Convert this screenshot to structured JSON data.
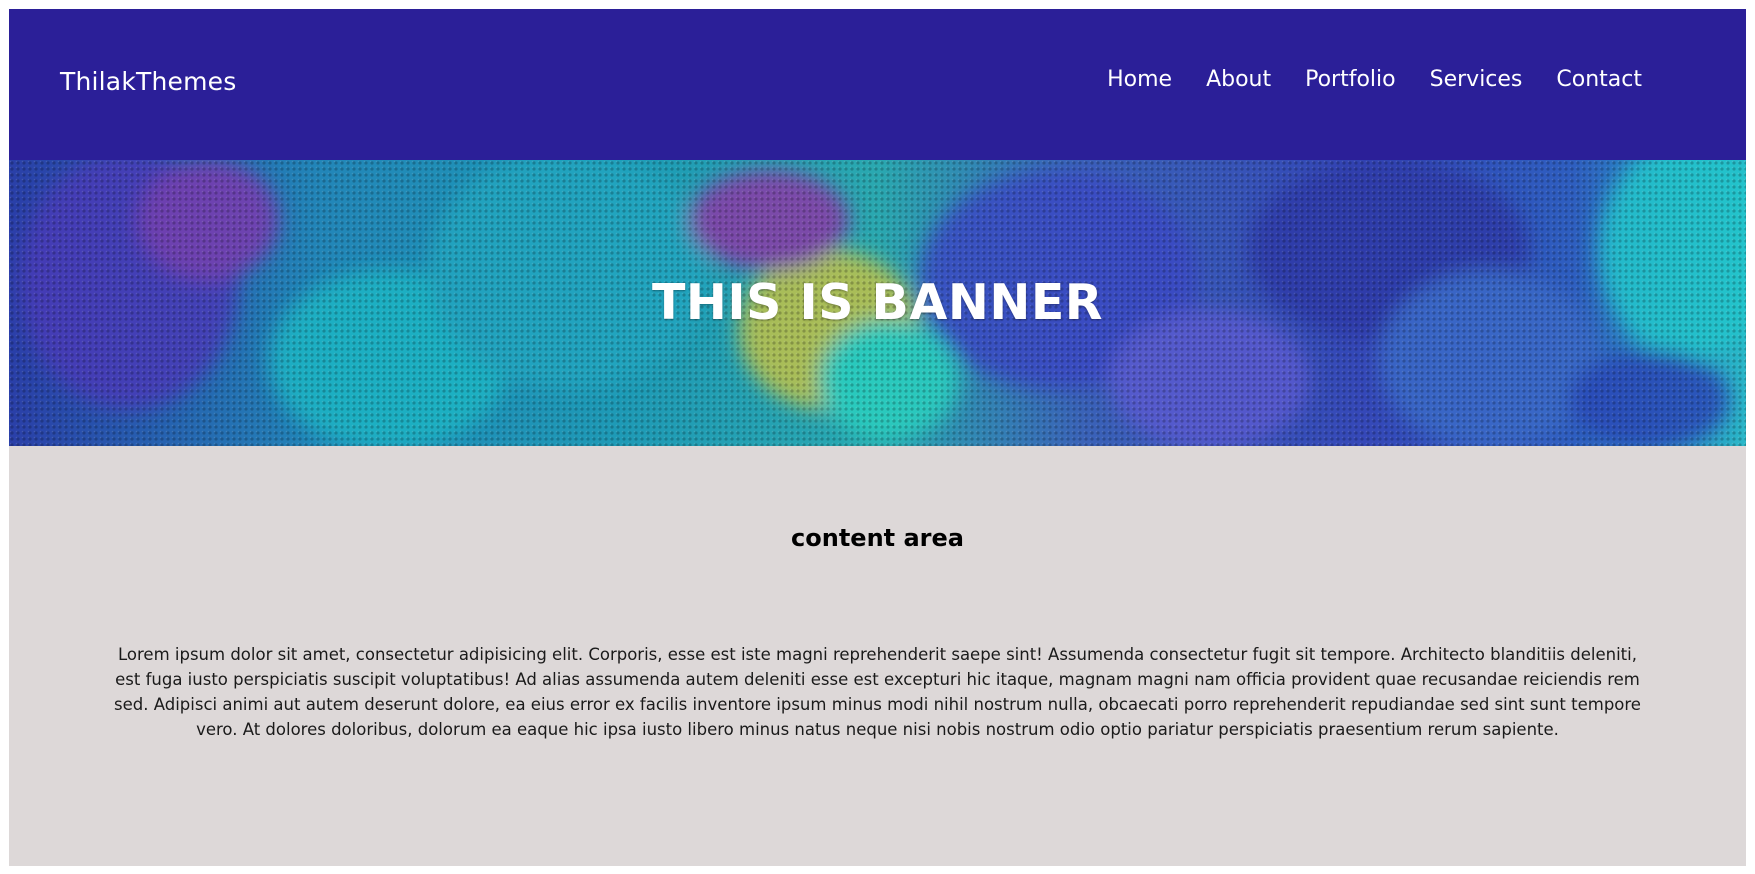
{
  "header": {
    "logo": "ThilakThemes",
    "nav": [
      "Home",
      "About",
      "Portfolio",
      "Services",
      "Contact"
    ],
    "background_color": "#2b1f98"
  },
  "banner": {
    "title": "THIS IS BANNER",
    "palette": [
      "#1a4fa0",
      "#1f9bb8",
      "#3a3fc0",
      "#6a3bb0",
      "#2cc4c8",
      "#b8c040"
    ]
  },
  "content": {
    "title": "content area",
    "body": "Lorem ipsum dolor sit amet, consectetur adipisicing elit. Corporis, esse est iste magni reprehenderit saepe sint! Assumenda consectetur fugit sit tempore. Architecto blanditiis deleniti, est fuga iusto perspiciatis suscipit voluptatibus! Ad alias assumenda autem deleniti esse est excepturi hic itaque, magnam magni nam officia provident quae recusandae reiciendis rem sed. Adipisci animi aut autem deserunt dolore, ea eius error ex facilis inventore ipsum minus modi nihil nostrum nulla, obcaecati porro reprehenderit repudiandae sed sint sunt tempore vero. At dolores doloribus, dolorum ea eaque hic ipsa iusto libero minus natus neque nisi nobis nostrum odio optio pariatur perspiciatis praesentium rerum sapiente.",
    "background_color": "#ddd8d8"
  }
}
